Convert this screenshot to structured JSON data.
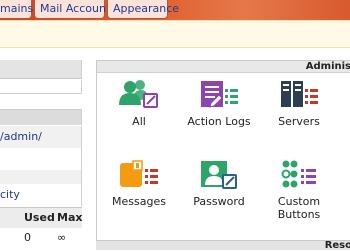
{
  "top_tabs": [
    {
      "label": "mains"
    },
    {
      "label": "Mail Accounts"
    },
    {
      "label": "Appearance"
    }
  ],
  "left_panel": {
    "rows": [
      "/admin/",
      "",
      "city"
    ]
  },
  "usage_table": {
    "headers": [
      "Used",
      "Max"
    ],
    "row": [
      "0",
      "∞"
    ]
  },
  "admin_panel": {
    "title": "Adminis",
    "items": [
      {
        "label": "All",
        "icon": "users-edit-icon"
      },
      {
        "label": "Action Logs",
        "icon": "action-logs-icon"
      },
      {
        "label": "Servers",
        "icon": "servers-icon"
      },
      {
        "label": "Messages",
        "icon": "messages-icon"
      },
      {
        "label": "Password",
        "icon": "password-icon"
      },
      {
        "label": "Custom Buttons",
        "icon": "custom-buttons-icon"
      }
    ]
  },
  "bottom_panel": {
    "title": "Reso"
  },
  "colors": {
    "banner": "#d0441c",
    "tab_bg": "#fbe3dc",
    "link": "#1f3a8a",
    "icon_green": "#2ea36a",
    "icon_purple": "#8e44ad",
    "icon_dark": "#2c3e50",
    "icon_orange": "#f39c12",
    "icon_red": "#c0392b"
  }
}
